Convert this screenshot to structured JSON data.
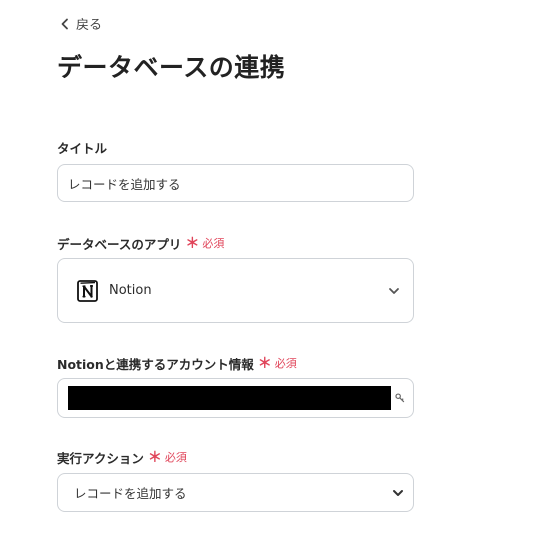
{
  "nav": {
    "back_label": "戻る"
  },
  "page": {
    "title": "データベースの連携"
  },
  "form": {
    "title_field": {
      "label": "タイトル",
      "value": "レコードを追加する"
    },
    "app_field": {
      "label": "データベースのアプリ",
      "required_mark": "＊",
      "required_text": "必須",
      "selected_app": "Notion",
      "app_icon": "notion-logo-icon"
    },
    "account_field": {
      "label": "Notionと連携するアカウント情報",
      "required_mark": "＊",
      "required_text": "必須",
      "icon": "key-icon"
    },
    "action_field": {
      "label": "実行アクション",
      "required_mark": "＊",
      "required_text": "必須",
      "selected_action": "レコードを追加する"
    }
  },
  "colors": {
    "required": "#e0455a",
    "border": "#cfd3d8",
    "text": "#2b2b2b"
  }
}
